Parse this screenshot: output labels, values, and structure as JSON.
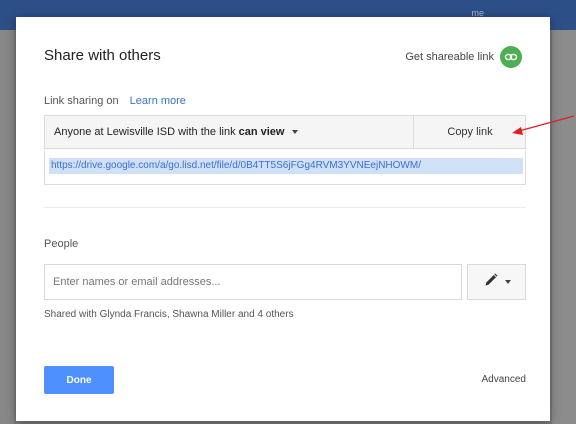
{
  "background": {
    "topbar_text": "me"
  },
  "dialog": {
    "title": "Share with others",
    "get_link_label": "Get shareable link",
    "link_sharing_label": "Link sharing on",
    "learn_more": "Learn more",
    "access": {
      "prefix": "Anyone at Lewisville ISD with the link",
      "level": "can view"
    },
    "copy_link_label": "Copy link",
    "url": "https://drive.google.com/a/go.lisd.net/file/d/0B4TT5S6jFGg4RVM3YVNEejNHOWM/",
    "people_label": "People",
    "people_input": {
      "placeholder": "Enter names or email addresses...",
      "value": ""
    },
    "shared_with": "Shared with Glynda Francis, Shawna Miller and 4 others",
    "done_label": "Done",
    "advanced_label": "Advanced"
  },
  "colors": {
    "topbar": "#2d4f88",
    "link_green": "#4caf50",
    "primary_blue": "#4d90fe",
    "link_blue": "#3b6fd4",
    "url_highlight": "#cfe0f7",
    "annotation_arrow": "#e02020"
  },
  "icons": {
    "get_link": "link-icon",
    "access_dropdown": "caret-down-icon",
    "permission": "pencil-icon",
    "permission_dropdown": "caret-down-icon"
  }
}
